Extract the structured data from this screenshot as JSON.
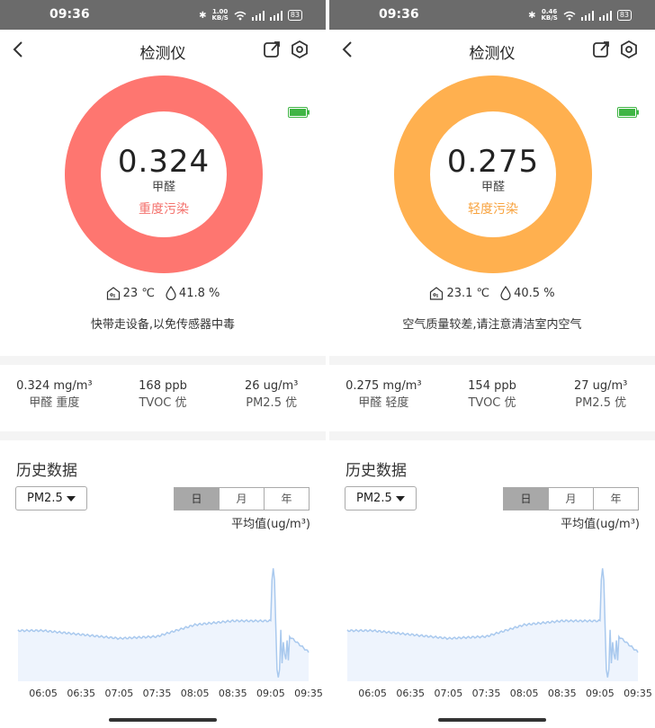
{
  "screens": [
    {
      "statusbar": {
        "time": "09:36",
        "net_speed": "1.00",
        "net_unit": "KB/S",
        "battery": "83"
      },
      "appbar": {
        "title": "检测仪"
      },
      "reading": {
        "value": "0.324",
        "pollutant": "甲醛",
        "level": "重度污染",
        "ring_color": "#fe7670",
        "level_color": "#f4726d"
      },
      "env": {
        "temperature": "23 ℃",
        "humidity": "41.8 %"
      },
      "advice": "快带走设备,以免传感器中毒",
      "metrics": [
        {
          "value": "0.324 mg/m³",
          "desc": "甲醛 重度"
        },
        {
          "value": "168 ppb",
          "desc": "TVOC 优"
        },
        {
          "value": "26 ug/m³",
          "desc": "PM2.5 优"
        }
      ],
      "history": {
        "title": "历史数据",
        "param": "PM2.5",
        "periods": [
          "日",
          "月",
          "年"
        ],
        "active_period": "日",
        "avg_label": "平均值(ug/m³)"
      },
      "chart_data": {
        "type": "area",
        "x": [
          "06:05",
          "06:35",
          "07:05",
          "07:35",
          "08:05",
          "08:35",
          "09:05",
          "09:35"
        ],
        "series": [
          {
            "values": [
              26,
              24,
              22,
              23,
              29,
              31,
              31,
              15
            ]
          }
        ],
        "spike": {
          "time": "09:10",
          "max": 58,
          "min": 2
        },
        "line_color": "#a9c9ee",
        "fill_color": "#eef4fd"
      }
    },
    {
      "statusbar": {
        "time": "09:36",
        "net_speed": "0.46",
        "net_unit": "KB/S",
        "battery": "83"
      },
      "appbar": {
        "title": "检测仪"
      },
      "reading": {
        "value": "0.275",
        "pollutant": "甲醛",
        "level": "轻度污染",
        "ring_color": "#ffb04f",
        "level_color": "#f8a33f"
      },
      "env": {
        "temperature": "23.1 ℃",
        "humidity": "40.5 %"
      },
      "advice": "空气质量较差,请注意清洁室内空气",
      "metrics": [
        {
          "value": "0.275 mg/m³",
          "desc": "甲醛 轻度"
        },
        {
          "value": "154 ppb",
          "desc": "TVOC 优"
        },
        {
          "value": "27 ug/m³",
          "desc": "PM2.5 优"
        }
      ],
      "history": {
        "title": "历史数据",
        "param": "PM2.5",
        "periods": [
          "日",
          "月",
          "年"
        ],
        "active_period": "日",
        "avg_label": "平均值(ug/m³)"
      },
      "chart_data": {
        "type": "area",
        "x": [
          "06:05",
          "06:35",
          "07:05",
          "07:35",
          "08:05",
          "08:35",
          "09:05",
          "09:35"
        ],
        "series": [
          {
            "values": [
              26,
              24,
              22,
              23,
              29,
              31,
              31,
              15
            ]
          }
        ],
        "spike": {
          "time": "09:10",
          "max": 58,
          "min": 2
        },
        "line_color": "#a9c9ee",
        "fill_color": "#eef4fd"
      }
    }
  ]
}
